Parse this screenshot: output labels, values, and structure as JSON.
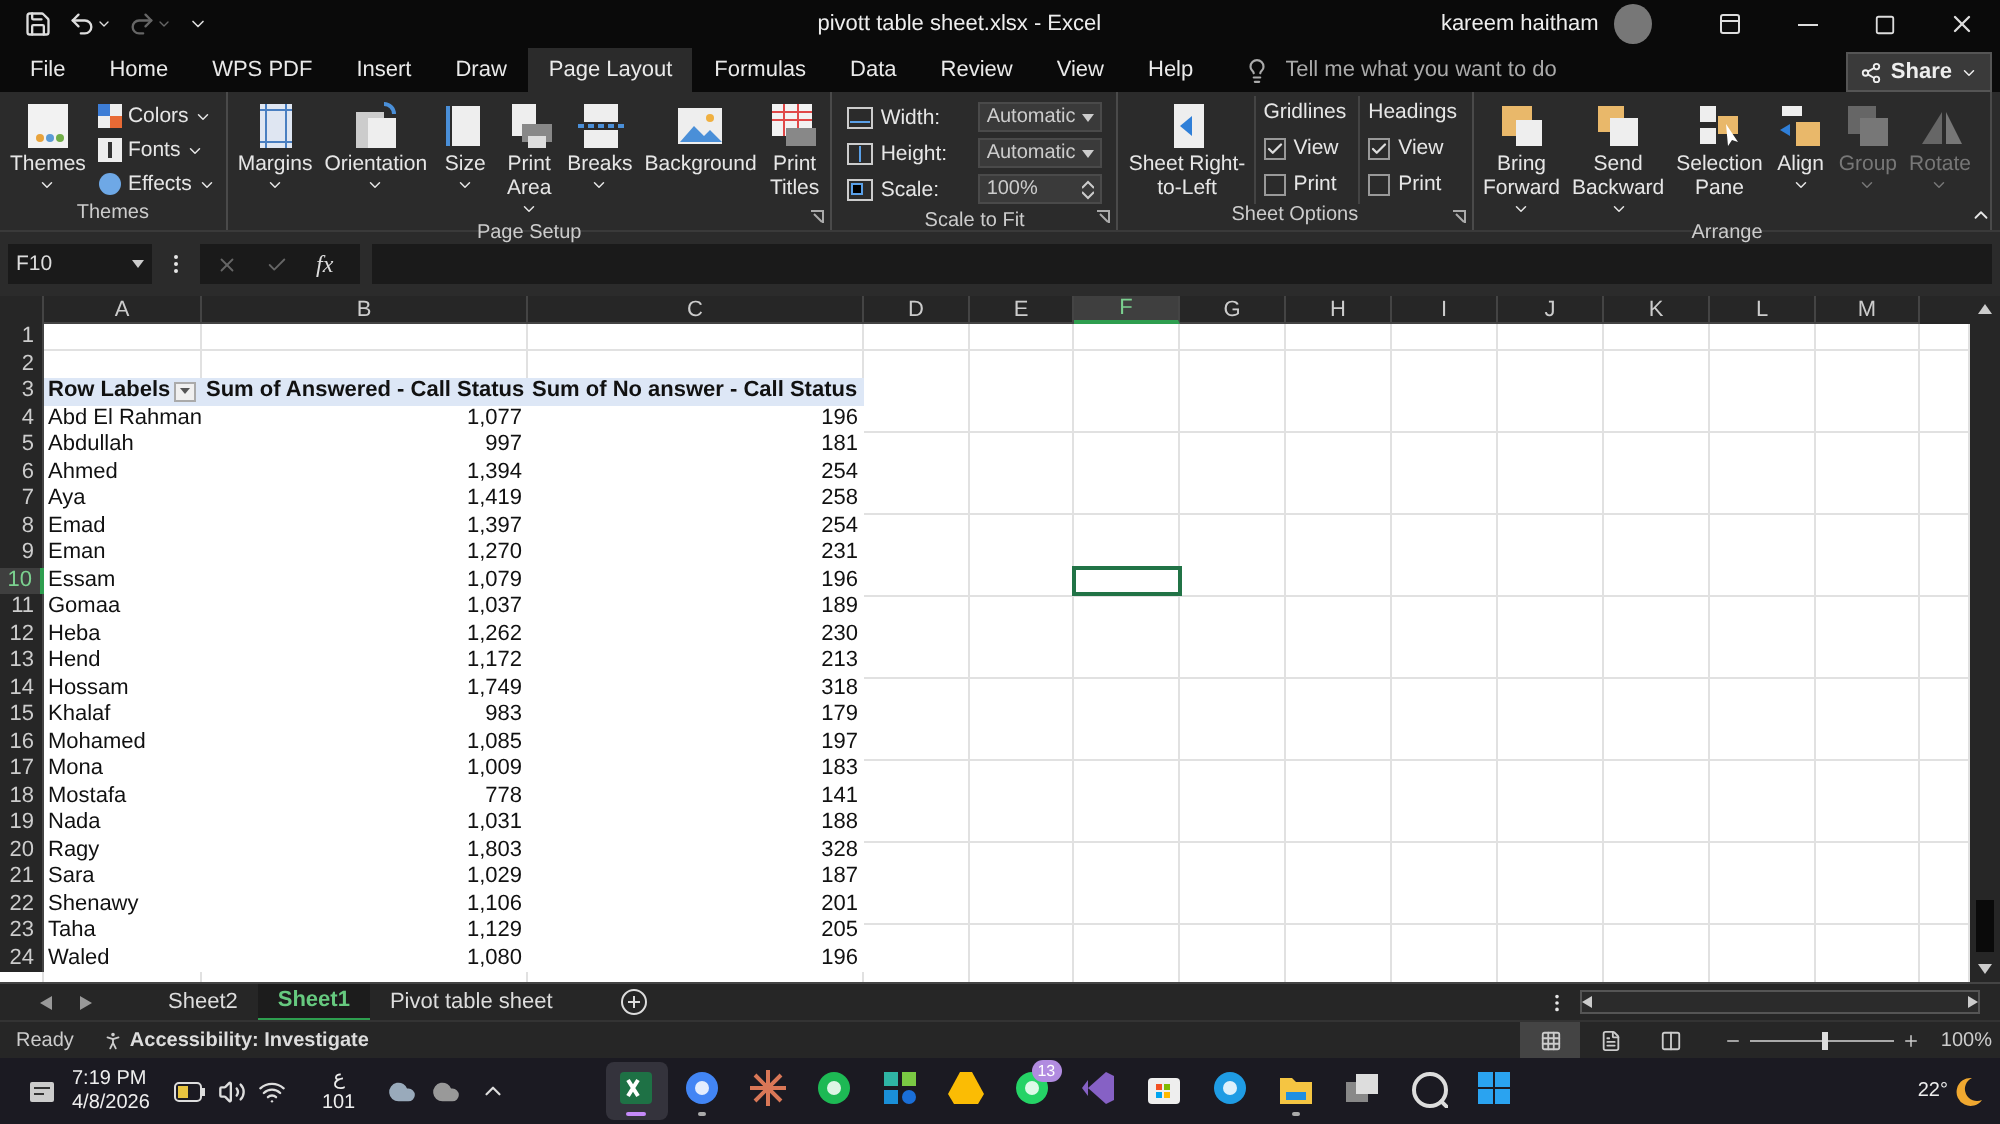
{
  "title_bar": {
    "file_title": "pivott table sheet.xlsx  -  Excel",
    "user": "kareem haitham"
  },
  "tabs": [
    {
      "label": "File",
      "selected": false
    },
    {
      "label": "Home",
      "selected": false
    },
    {
      "label": "WPS PDF",
      "selected": false
    },
    {
      "label": "Insert",
      "selected": false
    },
    {
      "label": "Draw",
      "selected": false
    },
    {
      "label": "Page Layout",
      "selected": true
    },
    {
      "label": "Formulas",
      "selected": false
    },
    {
      "label": "Data",
      "selected": false
    },
    {
      "label": "Review",
      "selected": false
    },
    {
      "label": "View",
      "selected": false
    },
    {
      "label": "Help",
      "selected": false
    }
  ],
  "tell_me": {
    "placeholder": "Tell me what you want to do"
  },
  "share": "Share",
  "ribbon": [
    {
      "label": "Themes",
      "launcher": false,
      "items": [
        {
          "kind": "big",
          "lines": [
            "Themes"
          ],
          "dropdown": true,
          "disabled": false
        },
        {
          "kind": "stack",
          "items": [
            {
              "label": "Colors",
              "dropdown": true
            },
            {
              "label": "Fonts",
              "dropdown": true
            },
            {
              "label": "Effects",
              "dropdown": true
            }
          ]
        }
      ]
    },
    {
      "label": "Page Setup",
      "launcher": true,
      "items": [
        {
          "kind": "big",
          "lines": [
            "Margins"
          ],
          "dropdown": true,
          "disabled": false
        },
        {
          "kind": "big",
          "lines": [
            "Orientation"
          ],
          "dropdown": true,
          "disabled": false
        },
        {
          "kind": "big",
          "lines": [
            "Size"
          ],
          "dropdown": true,
          "disabled": false
        },
        {
          "kind": "big",
          "lines": [
            "Print",
            "Area"
          ],
          "dropdown": true,
          "disabled": false
        },
        {
          "kind": "big",
          "lines": [
            "Breaks"
          ],
          "dropdown": true,
          "disabled": false
        },
        {
          "kind": "big",
          "lines": [
            "Background"
          ],
          "dropdown": false,
          "disabled": false
        },
        {
          "kind": "big",
          "lines": [
            "Print",
            "Titles"
          ],
          "dropdown": false,
          "disabled": false
        }
      ]
    },
    {
      "label": "Scale to Fit",
      "launcher": true,
      "items": [
        {
          "kind": "fields",
          "rows": [
            {
              "label": "Width:",
              "value": "Automatic",
              "kind": "dropdown"
            },
            {
              "label": "Height:",
              "value": "Automatic",
              "kind": "dropdown"
            },
            {
              "label": "Scale:",
              "value": "100%",
              "kind": "spinner"
            }
          ]
        }
      ]
    },
    {
      "label": "Sheet Options",
      "launcher": true,
      "items": [
        {
          "kind": "big",
          "lines": [
            "Sheet Right-",
            "to-Left"
          ],
          "dropdown": false,
          "disabled": false
        },
        {
          "kind": "checks",
          "title": "Gridlines",
          "items": [
            {
              "label": "View",
              "checked": true
            },
            {
              "label": "Print",
              "checked": false
            }
          ]
        },
        {
          "kind": "checks",
          "title": "Headings",
          "items": [
            {
              "label": "View",
              "checked": true
            },
            {
              "label": "Print",
              "checked": false
            }
          ]
        }
      ]
    },
    {
      "label": "Arrange",
      "launcher": false,
      "items": [
        {
          "kind": "big",
          "lines": [
            "Bring",
            "Forward"
          ],
          "dropdown": true,
          "disabled": false
        },
        {
          "kind": "big",
          "lines": [
            "Send",
            "Backward"
          ],
          "dropdown": true,
          "disabled": false
        },
        {
          "kind": "big",
          "lines": [
            "Selection",
            "Pane"
          ],
          "dropdown": false,
          "disabled": false
        },
        {
          "kind": "big",
          "lines": [
            "Align"
          ],
          "dropdown": true,
          "disabled": false
        },
        {
          "kind": "big",
          "lines": [
            "Group"
          ],
          "dropdown": true,
          "disabled": true
        },
        {
          "kind": "big",
          "lines": [
            "Rotate"
          ],
          "dropdown": true,
          "disabled": true
        }
      ]
    }
  ],
  "name_box": {
    "value": "F10"
  },
  "formula_bar": {
    "fx": "fx"
  },
  "columns": [
    {
      "letter": "A",
      "selected": false
    },
    {
      "letter": "B",
      "selected": false
    },
    {
      "letter": "C",
      "selected": false
    },
    {
      "letter": "D",
      "selected": false
    },
    {
      "letter": "E",
      "selected": false
    },
    {
      "letter": "F",
      "selected": true
    },
    {
      "letter": "G",
      "selected": false
    },
    {
      "letter": "H",
      "selected": false
    },
    {
      "letter": "I",
      "selected": false
    },
    {
      "letter": "J",
      "selected": false
    },
    {
      "letter": "K",
      "selected": false
    },
    {
      "letter": "L",
      "selected": false
    },
    {
      "letter": "M",
      "selected": false
    }
  ],
  "rows": [
    {
      "number": "1",
      "kind": "blank",
      "selected": false,
      "cells": []
    },
    {
      "number": "2",
      "kind": "blank",
      "selected": false,
      "cells": []
    },
    {
      "number": "3",
      "kind": "header",
      "selected": false,
      "cells": [
        "Row Labels",
        "Sum of Answered - Call Status",
        "Sum of No answer - Call Status"
      ]
    },
    {
      "number": "4",
      "kind": "data",
      "selected": false,
      "cells": [
        "Abd El Rahman",
        "1,077",
        "196"
      ]
    },
    {
      "number": "5",
      "kind": "data",
      "selected": false,
      "cells": [
        "Abdullah",
        "997",
        "181"
      ]
    },
    {
      "number": "6",
      "kind": "data",
      "selected": false,
      "cells": [
        "Ahmed",
        "1,394",
        "254"
      ]
    },
    {
      "number": "7",
      "kind": "data",
      "selected": false,
      "cells": [
        "Aya",
        "1,419",
        "258"
      ]
    },
    {
      "number": "8",
      "kind": "data",
      "selected": false,
      "cells": [
        "Emad",
        "1,397",
        "254"
      ]
    },
    {
      "number": "9",
      "kind": "data",
      "selected": false,
      "cells": [
        "Eman",
        "1,270",
        "231"
      ]
    },
    {
      "number": "10",
      "kind": "data",
      "selected": true,
      "cells": [
        "Essam",
        "1,079",
        "196"
      ]
    },
    {
      "number": "11",
      "kind": "data",
      "selected": false,
      "cells": [
        "Gomaa",
        "1,037",
        "189"
      ]
    },
    {
      "number": "12",
      "kind": "data",
      "selected": false,
      "cells": [
        "Heba",
        "1,262",
        "230"
      ]
    },
    {
      "number": "13",
      "kind": "data",
      "selected": false,
      "cells": [
        "Hend",
        "1,172",
        "213"
      ]
    },
    {
      "number": "14",
      "kind": "data",
      "selected": false,
      "cells": [
        "Hossam",
        "1,749",
        "318"
      ]
    },
    {
      "number": "15",
      "kind": "data",
      "selected": false,
      "cells": [
        "Khalaf",
        "983",
        "179"
      ]
    },
    {
      "number": "16",
      "kind": "data",
      "selected": false,
      "cells": [
        "Mohamed",
        "1,085",
        "197"
      ]
    },
    {
      "number": "17",
      "kind": "data",
      "selected": false,
      "cells": [
        "Mona",
        "1,009",
        "183"
      ]
    },
    {
      "number": "18",
      "kind": "data",
      "selected": false,
      "cells": [
        "Mostafa",
        "778",
        "141"
      ]
    },
    {
      "number": "19",
      "kind": "data",
      "selected": false,
      "cells": [
        "Nada",
        "1,031",
        "188"
      ]
    },
    {
      "number": "20",
      "kind": "data",
      "selected": false,
      "cells": [
        "Ragy",
        "1,803",
        "328"
      ]
    },
    {
      "number": "21",
      "kind": "data",
      "selected": false,
      "cells": [
        "Sara",
        "1,029",
        "187"
      ]
    },
    {
      "number": "22",
      "kind": "data",
      "selected": false,
      "cells": [
        "Shenawy",
        "1,106",
        "201"
      ]
    },
    {
      "number": "23",
      "kind": "data",
      "selected": false,
      "cells": [
        "Taha",
        "1,129",
        "205"
      ]
    },
    {
      "number": "24",
      "kind": "data",
      "selected": false,
      "cells": [
        "Waled",
        "1,080",
        "196"
      ]
    }
  ],
  "sheet_tabs": [
    {
      "label": "Sheet2",
      "selected": false
    },
    {
      "label": "Sheet1",
      "selected": true
    },
    {
      "label": "Pivot table sheet",
      "selected": false
    }
  ],
  "status_bar": {
    "status": "Ready",
    "accessibility": "Accessibility: Investigate",
    "views": [
      {
        "selected": true
      },
      {
        "selected": false
      },
      {
        "selected": false
      }
    ],
    "zoom": {
      "level": 0.5,
      "reading": "100%"
    }
  },
  "taskbar": {
    "time": "7:19 PM",
    "date": "4/8/2026",
    "language": "ع",
    "keyboard": "101",
    "apps": [
      {
        "selected": true,
        "running": true
      },
      {
        "selected": false,
        "running": true
      },
      {
        "selected": false,
        "running": false
      },
      {
        "selected": false,
        "running": false
      },
      {
        "selected": false,
        "running": false
      },
      {
        "selected": false,
        "running": false
      },
      {
        "selected": false,
        "running": false,
        "badge": "13"
      },
      {
        "selected": false,
        "running": false
      },
      {
        "selected": false,
        "running": false
      },
      {
        "selected": false,
        "running": false
      },
      {
        "selected": false,
        "running": true
      },
      {
        "selected": false,
        "running": false
      },
      {
        "selected": false,
        "running": false
      },
      {
        "selected": false,
        "running": false
      }
    ],
    "weather": "22°"
  }
}
